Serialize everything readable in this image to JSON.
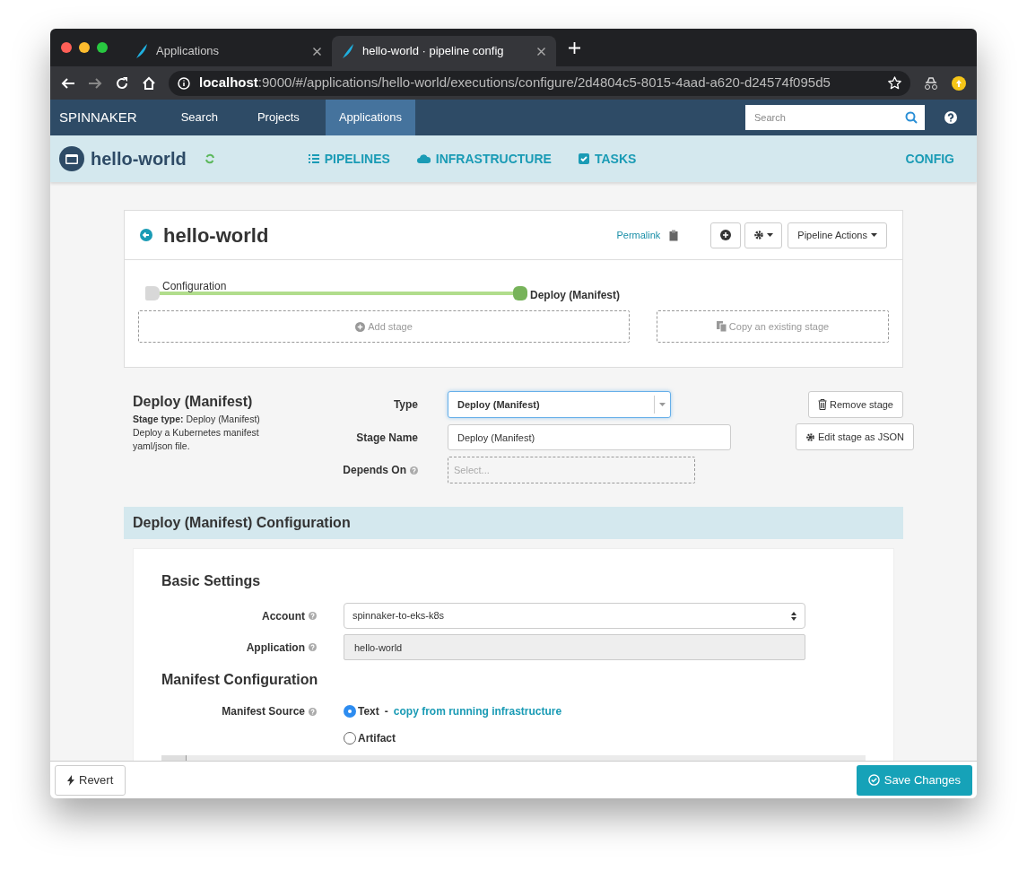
{
  "browser": {
    "tabs": [
      {
        "title": "Applications",
        "selected": false
      },
      {
        "title": "hello-world · pipeline config",
        "selected": true
      }
    ],
    "url_host": "localhost",
    "url_rest": ":9000/#/applications/hello-world/executions/configure/2d4804c5-8015-4aad-a620-d24574f095d5"
  },
  "nav": {
    "brand": "SPINNAKER",
    "items": [
      {
        "label": "Search",
        "selected": false
      },
      {
        "label": "Projects",
        "selected": false
      },
      {
        "label": "Applications",
        "selected": true
      }
    ],
    "search_placeholder": "Search"
  },
  "app": {
    "name": "hello-world",
    "sections": [
      {
        "label": "PIPELINES",
        "kind": "list"
      },
      {
        "label": "INFRASTRUCTURE",
        "kind": "cloud"
      },
      {
        "label": "TASKS",
        "kind": "check"
      }
    ],
    "config": "CONFIG"
  },
  "pipeline": {
    "name": "hello-world",
    "permalink": "Permalink",
    "actions": "Pipeline Actions",
    "stages": [
      {
        "label": "Configuration",
        "selected": false
      },
      {
        "label": "Deploy (Manifest)",
        "selected": true
      }
    ],
    "add_stage": "Add stage",
    "copy_stage": "Copy an existing stage"
  },
  "stage": {
    "title": "Deploy (Manifest)",
    "stage_type": "**Stage type:** Deploy (Manifest)",
    "description": "Deploy a Kubernetes manifest yaml/json file.",
    "type_label": "Type",
    "type_value": "Deploy (Manifest)",
    "name_label": "Stage Name",
    "name_value": "Deploy (Manifest)",
    "depends_label": "Depends On",
    "depends_placeholder": "Select...",
    "remove": "Remove stage",
    "edit_json": "Edit stage as JSON"
  },
  "config": {
    "title": "Deploy (Manifest) Configuration",
    "basic_heading": "Basic Settings",
    "account_label": "Account",
    "account_value": "spinnaker-to-eks-k8s",
    "application_label": "Application",
    "application_value": "hello-world",
    "manifest_heading": "Manifest Configuration",
    "source_label": "Manifest Source",
    "source_options": [
      {
        "label": "Text",
        "separator": "-",
        "link": "copy from running infrastructure",
        "selected": true
      },
      {
        "label": "Artifact",
        "selected": false
      }
    ]
  },
  "footer": {
    "revert": "Revert",
    "save": "Save Changes"
  }
}
